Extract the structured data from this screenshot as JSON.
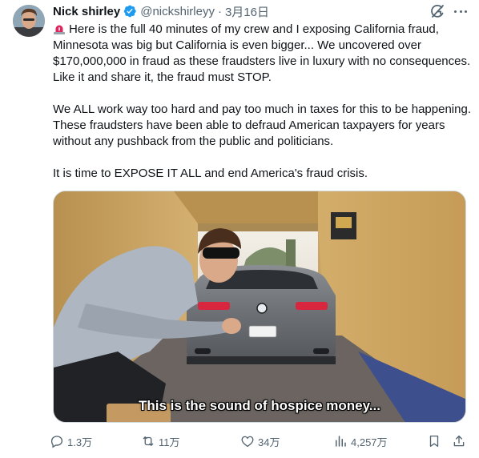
{
  "tweet": {
    "author_name": "Nick shirley",
    "handle": "@nickshirleyy",
    "separator": "·",
    "date": "3月16日",
    "text": {
      "p1": "Here is the full 40 minutes of my crew and I exposing California fraud, Minnesota was big but California is even bigger... We uncovered over $170,000,000 in fraud as these fraudsters live in luxury with no consequences. Like it and share it, the fraud must STOP.",
      "p2": "We ALL work way too hard and pay too much in taxes for this to be happening. These fraudsters have been able to defraud American taxpayers for years without any pushback from the public and politicians.",
      "p3": "It is time to EXPOSE IT ALL and end America's fraud crisis."
    },
    "media": {
      "caption": "This is the sound of hospice money..."
    }
  },
  "actions": {
    "replies": "1.3万",
    "reposts": "11万",
    "likes": "34万",
    "views": "4,257万"
  },
  "icons": {
    "verified": "verified-badge-icon",
    "grok": "grok-icon",
    "more": "more-icon",
    "siren": "siren-emoji-icon",
    "reply": "reply-icon",
    "repost": "repost-icon",
    "like": "like-icon",
    "views": "views-icon",
    "bookmark": "bookmark-icon",
    "share": "share-icon"
  },
  "colors": {
    "accent": "#1d9bf0",
    "text": "#0f1419",
    "secondary": "#536471"
  }
}
